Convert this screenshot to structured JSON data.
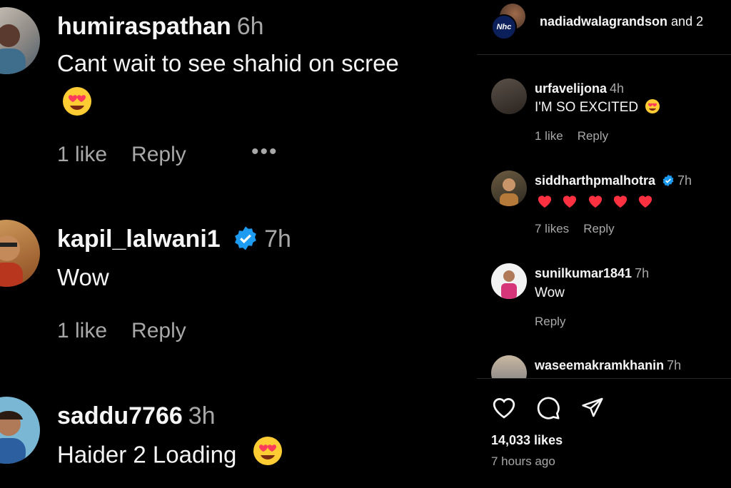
{
  "left_comments": [
    {
      "username": "humiraspathan",
      "time": "6h",
      "text": "Cant wait to see shahid on scree",
      "likes": "1 like",
      "reply": "Reply"
    },
    {
      "username": "kapil_lalwani1",
      "time": "7h",
      "text": "Wow",
      "likes": "1 like",
      "reply": "Reply"
    },
    {
      "username": "saddu7766",
      "time": "3h",
      "text": "Haider 2 Loading"
    }
  ],
  "post_header": {
    "avatar_text": "Nhc",
    "username": "nadiadwalagrandson",
    "rest": " and 2"
  },
  "right_comments": [
    {
      "username": "urfavelijona",
      "time": "4h",
      "text": "I'M SO EXCITED",
      "likes": "1 like",
      "reply": "Reply"
    },
    {
      "username": "siddharthpmalhotra",
      "time": "7h",
      "likes": "7 likes",
      "reply": "Reply"
    },
    {
      "username": "sunilkumar1841",
      "time": "7h",
      "text": "Wow",
      "reply": "Reply"
    },
    {
      "username": "waseemakramkhanin",
      "time": "7h"
    }
  ],
  "post": {
    "likes": "14,033 likes",
    "time_ago": "7 hours ago"
  },
  "icons": [
    "heart-icon",
    "comment-icon",
    "share-icon",
    "verified-badge-icon",
    "heart-eyes-emoji",
    "red-heart-emoji",
    "more-options-icon"
  ],
  "colors": {
    "background": "#000000",
    "text": "#f5f5f5",
    "muted": "#a8a8a8",
    "verified": "#1d9bf0",
    "heart": "#ff3040"
  }
}
